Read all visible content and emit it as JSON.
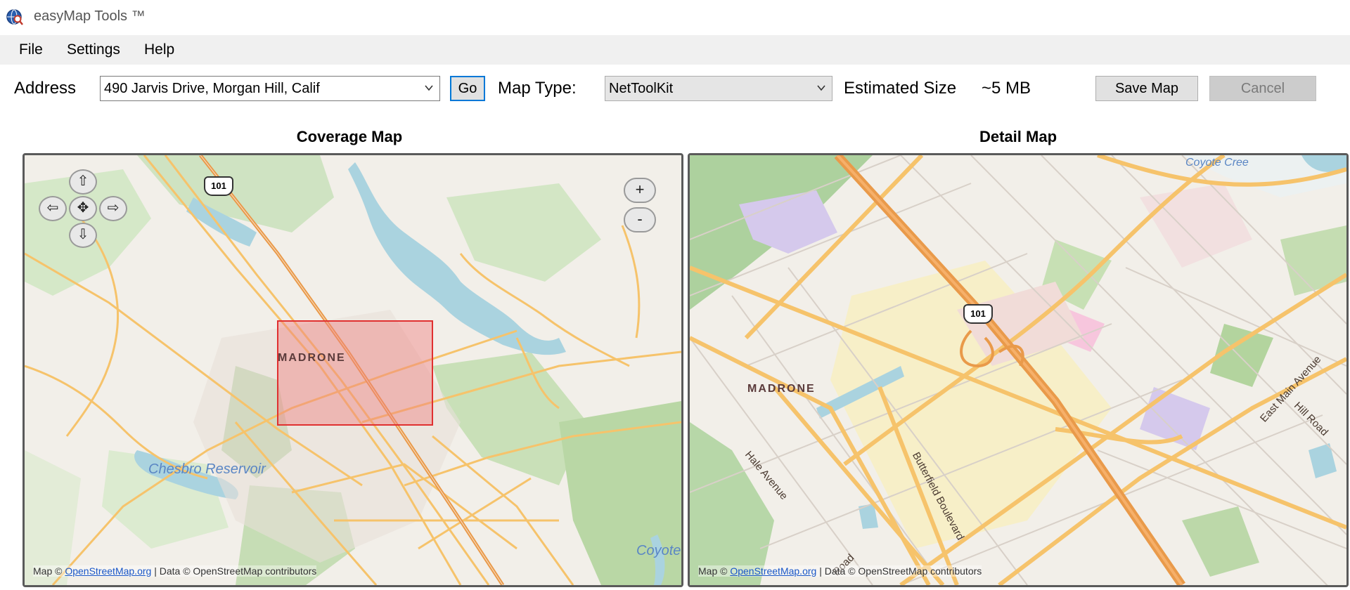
{
  "window": {
    "title": "easyMap Tools ™",
    "icon": "globe-magnifier-icon"
  },
  "menu": {
    "items": [
      "File",
      "Settings",
      "Help"
    ]
  },
  "toolbar": {
    "address_label": "Address",
    "address_value": "490 Jarvis Drive, Morgan Hill, Calif",
    "go_label": "Go",
    "map_type_label": "Map Type:",
    "map_type_value": "NetToolKit",
    "estimated_size_label": "Estimated Size",
    "estimated_size_value": "~5 MB",
    "save_label": "Save Map",
    "cancel_label": "Cancel"
  },
  "coverage_map": {
    "title": "Coverage Map",
    "nav": {
      "up": "⇧",
      "down": "⇩",
      "left": "⇦",
      "right": "⇨",
      "center": "✥"
    },
    "zoom": {
      "in": "+",
      "out": "-"
    },
    "labels": {
      "place": "MADRONE",
      "reservoir": "Chesbro Reservoir",
      "coyote": "Coyote",
      "highway": "101"
    },
    "attribution": {
      "prefix": "Map © ",
      "link": "OpenStreetMap.org",
      "suffix": " | Data © OpenStreetMap contributors"
    },
    "selection_color": "#f08080"
  },
  "detail_map": {
    "title": "Detail Map",
    "labels": {
      "place": "MADRONE",
      "highway": "101",
      "hale": "Hale Avenue",
      "butterfield": "Butterfield Boulevard",
      "east_main": "East Main Avenue",
      "hill_road": "Hill Road",
      "road": "Road",
      "coyote_creek": "Coyote Cree"
    },
    "attribution": {
      "prefix": "Map © ",
      "link": "OpenStreetMap.org",
      "suffix": " | Data © OpenStreetMap contributors"
    }
  },
  "colors": {
    "accent": "#0078d7",
    "map_bg": "#f2efe9",
    "water": "#aad3df",
    "park": "#add19e",
    "road": "#f7c66a",
    "highway": "#e99a4a"
  }
}
